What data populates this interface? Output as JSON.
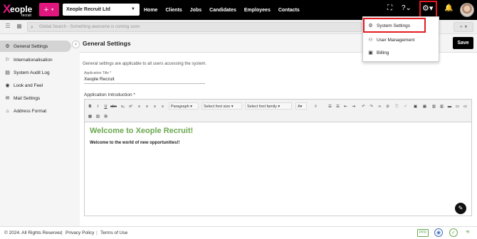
{
  "logo": {
    "first": "X",
    "rest": "eople",
    "sub": "recruit"
  },
  "add_button": {
    "label": "+"
  },
  "company_select": {
    "value": "Xeople Recruit Ltd"
  },
  "nav": [
    "Home",
    "Clients",
    "Jobs",
    "Candidates",
    "Employees",
    "Contacts"
  ],
  "search": {
    "placeholder": "Global Search - Something awesome is coming soon"
  },
  "sidebar": {
    "items": [
      {
        "label": "General Settings",
        "icon": "gear-icon",
        "active": true
      },
      {
        "label": "Internationalisation",
        "icon": "flag-icon"
      },
      {
        "label": "System Audit Log",
        "icon": "audit-icon"
      },
      {
        "label": "Look and Feel",
        "icon": "eye-icon"
      },
      {
        "label": "Mail Settings",
        "icon": "mail-icon"
      },
      {
        "label": "Address Format",
        "icon": "home-icon"
      }
    ]
  },
  "main": {
    "title": "General Settings",
    "save_label": "Save",
    "info": "General settings are applicable to all users accessing the system.",
    "app_title_label": "Application Title *",
    "app_title_value": "Xeople Recruit",
    "intro_label": "Application Introduction *"
  },
  "editor": {
    "paragraph": "Paragraph",
    "font_size": "Select font size",
    "font_family": "Select font family",
    "font_color": "A",
    "content_title": "Welcome to Xeople Recruit!",
    "content_text": "Welcome to the world of new opportunities!!"
  },
  "settings_menu": {
    "items": [
      {
        "label": "System Settings",
        "icon": "gears-icon"
      },
      {
        "label": "User Management",
        "icon": "user-gear-icon"
      },
      {
        "label": "Billing",
        "icon": "billing-icon"
      }
    ]
  },
  "footer": {
    "copyright": "© 2024. All Rights Reserved",
    "privacy": "Privacy Policy",
    "terms": "Terms of Use",
    "badge": "PPD"
  },
  "colors": {
    "brand": "#e0177f",
    "highlight": "#e21b23",
    "welcome": "#6aa84f"
  }
}
